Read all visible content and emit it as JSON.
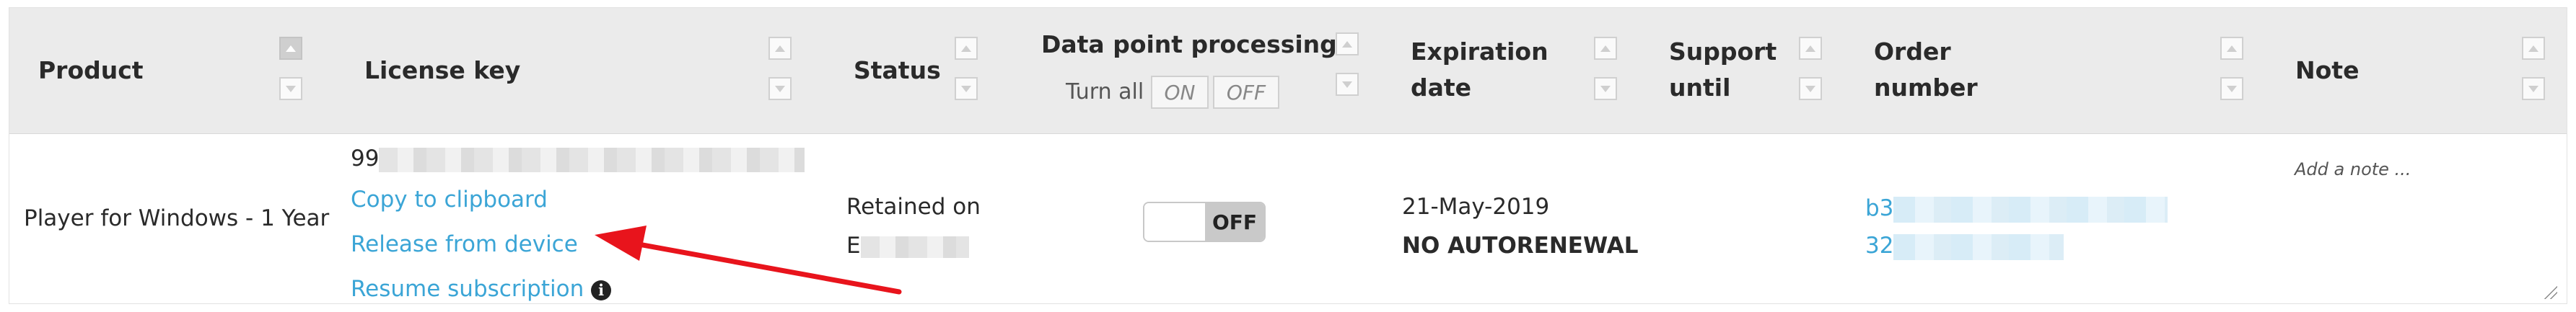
{
  "header": {
    "product": "Product",
    "license_key": "License key",
    "status": "Status",
    "data_point_processing": "Data point processing",
    "turn_all": "Turn all",
    "on": "ON",
    "off": "OFF",
    "expiration_line1": "Expiration",
    "expiration_line2": "date",
    "support_line1": "Support",
    "support_line2": "until",
    "order_line1": "Order",
    "order_line2": "number",
    "note": "Note"
  },
  "row": {
    "product": "Player for Windows - 1 Year",
    "license_key_prefix": "99",
    "copy_to_clipboard": "Copy to clipboard",
    "release_from_device": "Release from device",
    "resume_subscription": "Resume subscription",
    "status_line1": "Retained on",
    "status_line2_prefix": "E",
    "data_point_toggle": "OFF",
    "expiration_date": "21-May-2019",
    "renewal": "NO AUTORENEWAL",
    "order_line1_prefix": "b3",
    "order_line2_prefix": "32",
    "note_placeholder": "Add a note ..."
  },
  "icons": {
    "info": "i"
  },
  "colors": {
    "link": "#3ba5d6",
    "header_bg": "#ebebeb",
    "arrow": "#e8141c"
  }
}
